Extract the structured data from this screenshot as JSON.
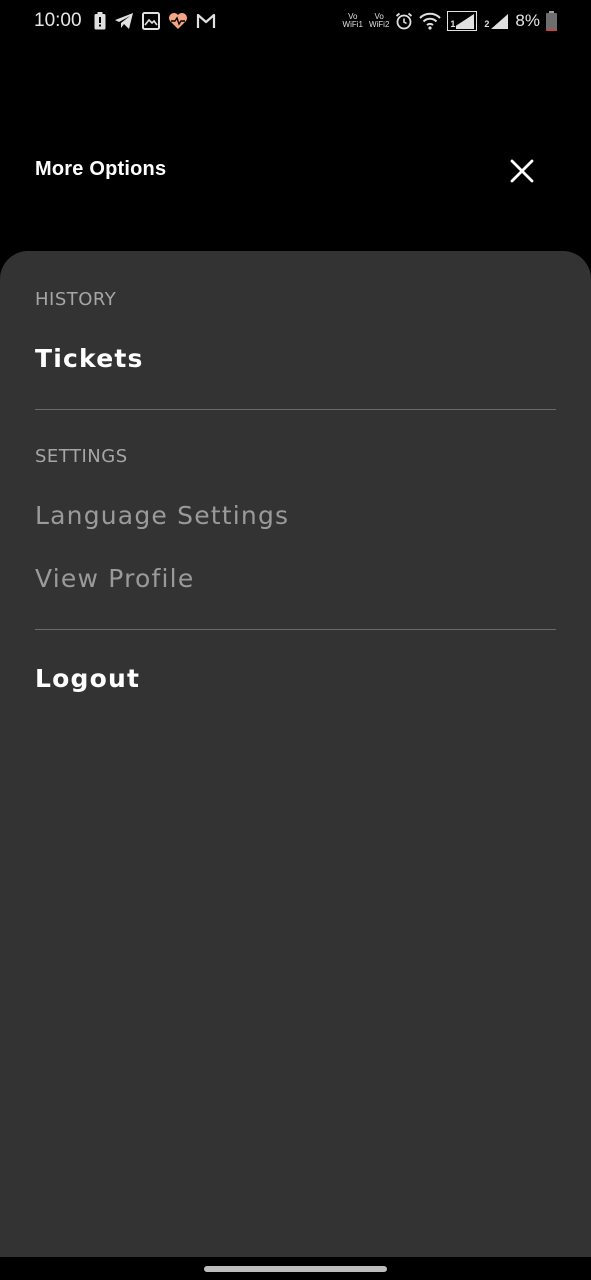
{
  "status_bar": {
    "time": "10:00",
    "vowifi1": {
      "top": "Vo",
      "bottom": "WiFi1"
    },
    "vowifi2": {
      "top": "Vo",
      "bottom": "WiFi2"
    },
    "sim1_label": "1",
    "sim2_label": "2",
    "battery_percent": "8%",
    "battery_level": 0.08,
    "colors": {
      "battery_low": "#e53935",
      "health_icon": "#f4a582"
    },
    "icons": [
      "battery-alert-icon",
      "telegram-icon",
      "gallery-icon",
      "health-icon",
      "gmail-icon",
      "alarm-icon",
      "wifi-icon",
      "signal-icon"
    ]
  },
  "header": {
    "title": "More Options",
    "close_icon": "close-icon"
  },
  "menu": {
    "history_label": "HISTORY",
    "tickets": "Tickets",
    "settings_label": "SETTINGS",
    "language_settings": "Language Settings",
    "view_profile": "View Profile",
    "logout": "Logout"
  },
  "colors": {
    "background": "#000000",
    "sheet": "#333333",
    "section_label": "#a6a6a6",
    "item_active": "#ffffff",
    "item_dim": "#9a9a9a",
    "divider": "#6a6a6a"
  }
}
